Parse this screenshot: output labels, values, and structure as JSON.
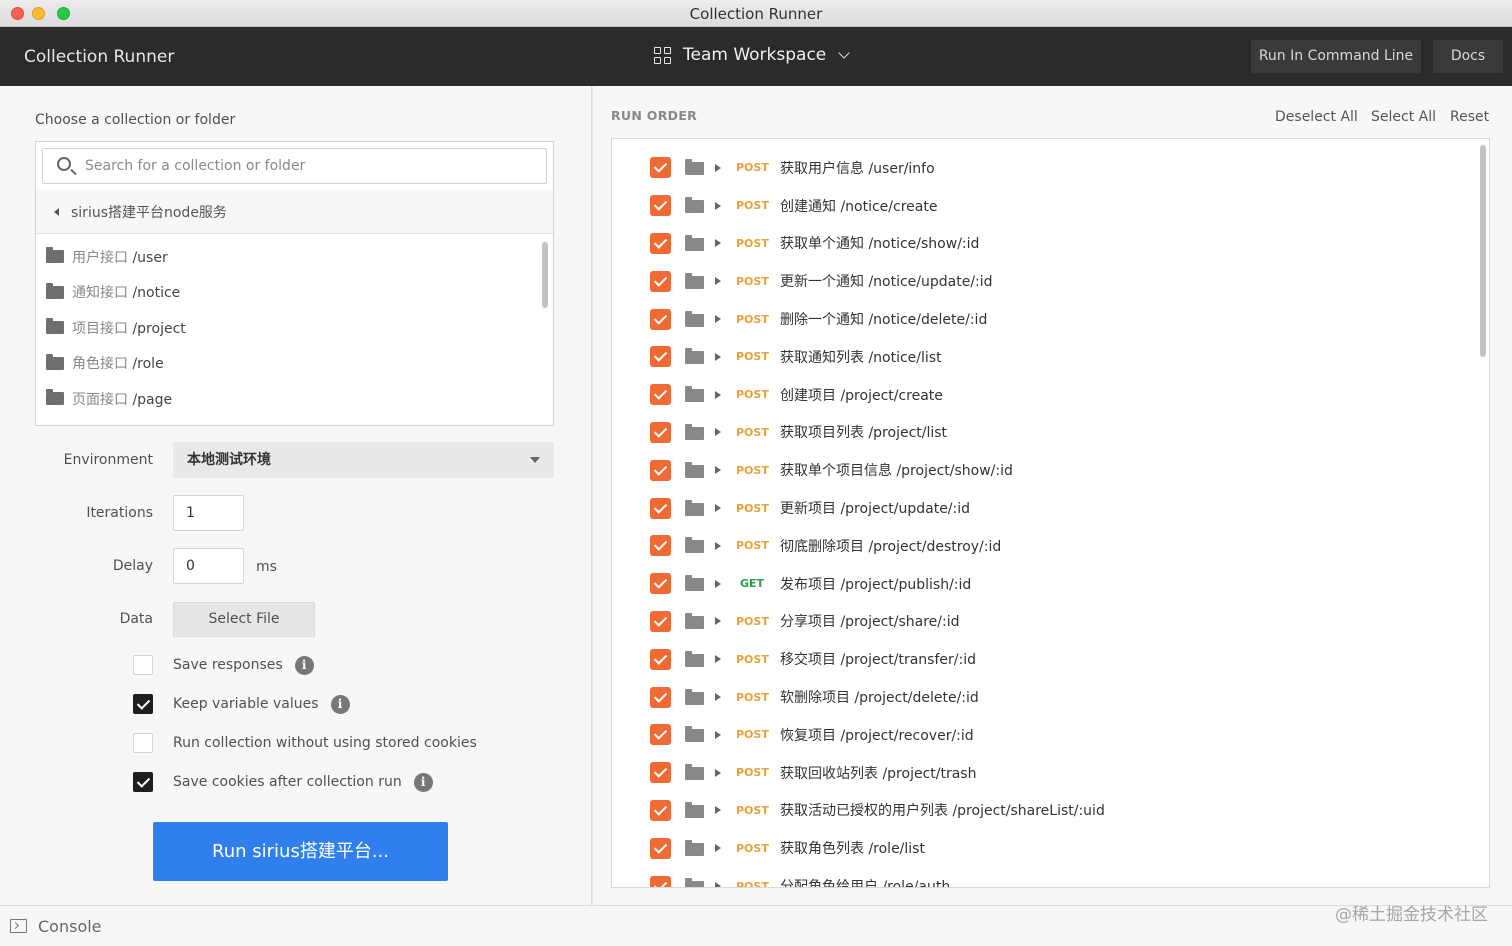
{
  "window": {
    "title": "Collection Runner"
  },
  "header": {
    "app_title": "Collection Runner",
    "workspace": "Team Workspace",
    "run_cmd_label": "Run In Command Line",
    "docs_label": "Docs"
  },
  "left": {
    "choose_label": "Choose a collection or folder",
    "search_placeholder": "Search for a collection or folder",
    "breadcrumb": "sirius搭建平台node服务",
    "folders": [
      {
        "cn": "用户接口",
        "path": "/user"
      },
      {
        "cn": "通知接口",
        "path": "/notice"
      },
      {
        "cn": "项目接口",
        "path": "/project"
      },
      {
        "cn": "角色接口",
        "path": "/role"
      },
      {
        "cn": "页面接口",
        "path": "/page"
      }
    ],
    "environment_label": "Environment",
    "environment_value": "本地测试环境",
    "iterations_label": "Iterations",
    "iterations_value": "1",
    "delay_label": "Delay",
    "delay_value": "0",
    "delay_unit": "ms",
    "data_label": "Data",
    "select_file_label": "Select File",
    "options": [
      {
        "label": "Save responses",
        "checked": false,
        "info": true
      },
      {
        "label": "Keep variable values",
        "checked": true,
        "info": true
      },
      {
        "label": "Run collection without using stored cookies",
        "checked": false,
        "info": false
      },
      {
        "label": "Save cookies after collection run",
        "checked": true,
        "info": true
      }
    ],
    "run_button_label": "Run sirius搭建平台..."
  },
  "right": {
    "title": "RUN ORDER",
    "deselect_all": "Deselect All",
    "select_all": "Select All",
    "reset": "Reset",
    "requests": [
      {
        "method": "POST",
        "name": "获取用户信息 /user/info"
      },
      {
        "method": "POST",
        "name": "创建通知 /notice/create"
      },
      {
        "method": "POST",
        "name": "获取单个通知 /notice/show/:id"
      },
      {
        "method": "POST",
        "name": "更新一个通知 /notice/update/:id"
      },
      {
        "method": "POST",
        "name": "删除一个通知 /notice/delete/:id"
      },
      {
        "method": "POST",
        "name": "获取通知列表 /notice/list"
      },
      {
        "method": "POST",
        "name": "创建项目 /project/create"
      },
      {
        "method": "POST",
        "name": "获取项目列表 /project/list"
      },
      {
        "method": "POST",
        "name": "获取单个项目信息 /project/show/:id"
      },
      {
        "method": "POST",
        "name": "更新项目 /project/update/:id"
      },
      {
        "method": "POST",
        "name": "彻底删除项目 /project/destroy/:id"
      },
      {
        "method": "GET",
        "name": "发布项目 /project/publish/:id"
      },
      {
        "method": "POST",
        "name": "分享项目 /project/share/:id"
      },
      {
        "method": "POST",
        "name": "移交项目 /project/transfer/:id"
      },
      {
        "method": "POST",
        "name": "软删除项目 /project/delete/:id"
      },
      {
        "method": "POST",
        "name": "恢复项目 /project/recover/:id"
      },
      {
        "method": "POST",
        "name": "获取回收站列表 /project/trash"
      },
      {
        "method": "POST",
        "name": "获取活动已授权的用户列表 /project/shareList/:uid"
      },
      {
        "method": "POST",
        "name": "获取角色列表 /role/list"
      },
      {
        "method": "POST",
        "name": "分配角色给用户 /role/auth"
      }
    ]
  },
  "footer": {
    "console_label": "Console",
    "watermark": "@稀土掘金技术社区"
  },
  "colors": {
    "accent_orange": "#f06a35",
    "run_blue": "#2f80ed",
    "post": "#e8a13b",
    "get": "#23a44a"
  }
}
